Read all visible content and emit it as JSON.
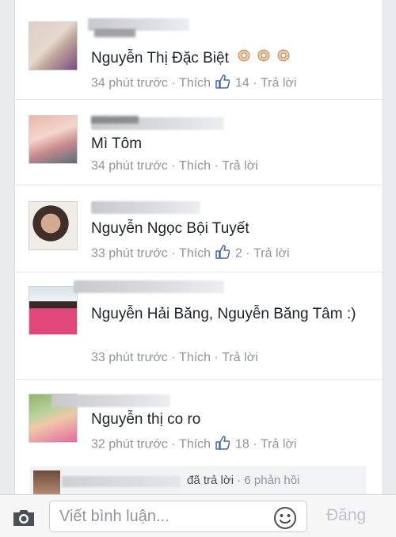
{
  "comments": [
    {
      "text": "Nguyễn Thị Đặc Biệt",
      "emoji": "👌👌👌",
      "time": "34 phút trước",
      "like_label": "Thích",
      "like_count": "14",
      "reply_label": "Trả lời",
      "avatar_colors": [
        "#d9d0c6",
        "#c2a99c",
        "#7a4b7e"
      ]
    },
    {
      "text": "Mì Tôm",
      "time": "34 phút trước",
      "like_label": "Thích",
      "like_count": "",
      "reply_label": "Trả lời",
      "avatar_colors": [
        "#e8b9a9",
        "#c88a8d",
        "#5a6d7b"
      ]
    },
    {
      "text": "Nguyễn Ngọc Bội Tuyết",
      "time": "33 phút trước",
      "like_label": "Thích",
      "like_count": "2",
      "reply_label": "Trả lời",
      "avatar_colors": [
        "#f1ede6",
        "#3e2f29",
        "#d2aa92"
      ]
    },
    {
      "text": "Nguyễn Hải Băng, Nguyễn Băng Tâm :)",
      "time": "33 phút trước",
      "like_label": "Thích",
      "like_count": "",
      "reply_label": "Trả lời",
      "avatar_colors": [
        "#d6e2ea",
        "#e2477a",
        "#3a2a26"
      ]
    },
    {
      "text": "Nguyễn thị co ro",
      "time": "32 phút trước",
      "like_label": "Thích",
      "like_count": "18",
      "reply_label": "Trả lời",
      "avatar_colors": [
        "#8fb36d",
        "#e46ba0",
        "#f0c8a8"
      ]
    }
  ],
  "reply_preview": {
    "action": "đã trả lời",
    "count": "6 phản hồi"
  },
  "composer": {
    "placeholder": "Viết bình luận...",
    "post_label": "Đăng"
  },
  "colors": {
    "meta_gray": "#90949c",
    "text": "#1d2129",
    "like_blue": "#4267b2"
  }
}
